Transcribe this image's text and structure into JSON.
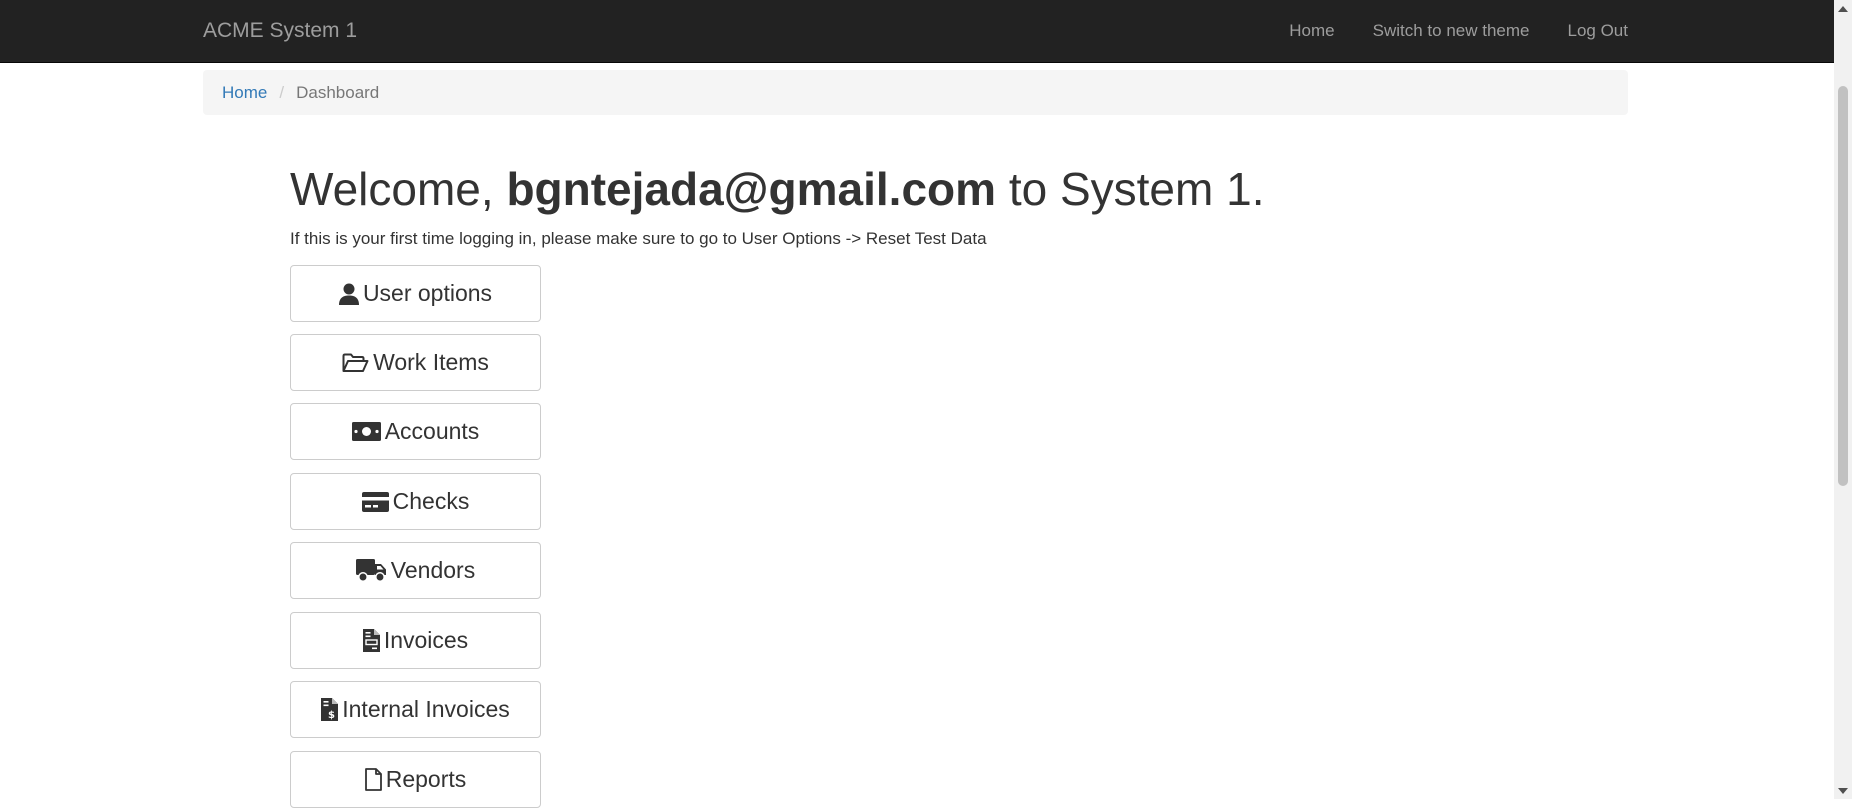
{
  "navbar": {
    "brand": "ACME System 1",
    "links": [
      "Home",
      "Switch to new theme",
      "Log Out"
    ]
  },
  "breadcrumb": {
    "home": "Home",
    "separator": "/",
    "current": "Dashboard"
  },
  "welcome": {
    "prefix": "Welcome, ",
    "email": "bgntejada@gmail.com",
    "suffix": " to System 1."
  },
  "intro_text": "If this is your first time logging in, please make sure to go to User Options -> Reset Test Data",
  "buttons": [
    {
      "label": "User options",
      "icon": "user-icon"
    },
    {
      "label": "Work Items",
      "icon": "folder-open-icon"
    },
    {
      "label": "Accounts",
      "icon": "money-bill-icon"
    },
    {
      "label": "Checks",
      "icon": "credit-card-icon"
    },
    {
      "label": "Vendors",
      "icon": "truck-icon"
    },
    {
      "label": "Invoices",
      "icon": "file-invoice-icon"
    },
    {
      "label": "Internal Invoices",
      "icon": "file-invoice-dollar-icon"
    },
    {
      "label": "Reports",
      "icon": "file-icon"
    }
  ],
  "colors": {
    "navbar_bg": "#222222",
    "navbar_text": "#9d9d9d",
    "link": "#337ab7",
    "breadcrumb_bg": "#f5f5f5",
    "button_border": "#cccccc",
    "text": "#333333"
  }
}
